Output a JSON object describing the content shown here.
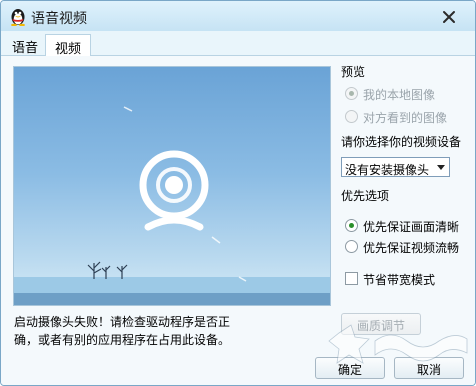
{
  "window": {
    "title": "语音视频",
    "close_icon": "close-icon",
    "title_icon": "qq-penguin-icon"
  },
  "tabs": [
    {
      "label": "语音",
      "active": false
    },
    {
      "label": "视频",
      "active": true
    }
  ],
  "preview": {
    "status_line_1": "启动摄像头失败！请检查驱动程序是否正",
    "status_line_2": "确，或者有别的应用程序在占用此设备。",
    "camera_icon": "webcam-icon"
  },
  "options": {
    "preview_heading": "预览",
    "preview_local": "我的本地图像",
    "preview_remote": "对方看到的图像",
    "device_heading": "请你选择你的视频设备",
    "device_selected": "没有安装摄像头",
    "priority_heading": "优先选项",
    "priority_quality": "优先保证画面清晰",
    "priority_smooth": "优先保证视频流畅",
    "bandwidth_saving": "节省带宽模式",
    "quality_button": "画质调节"
  },
  "footer": {
    "ok_label": "确定",
    "cancel_label": "取消"
  },
  "colors": {
    "accent_green": "#2a8f2a",
    "window_border": "#7aa7c7",
    "titlebar": "#c6e3f4"
  }
}
